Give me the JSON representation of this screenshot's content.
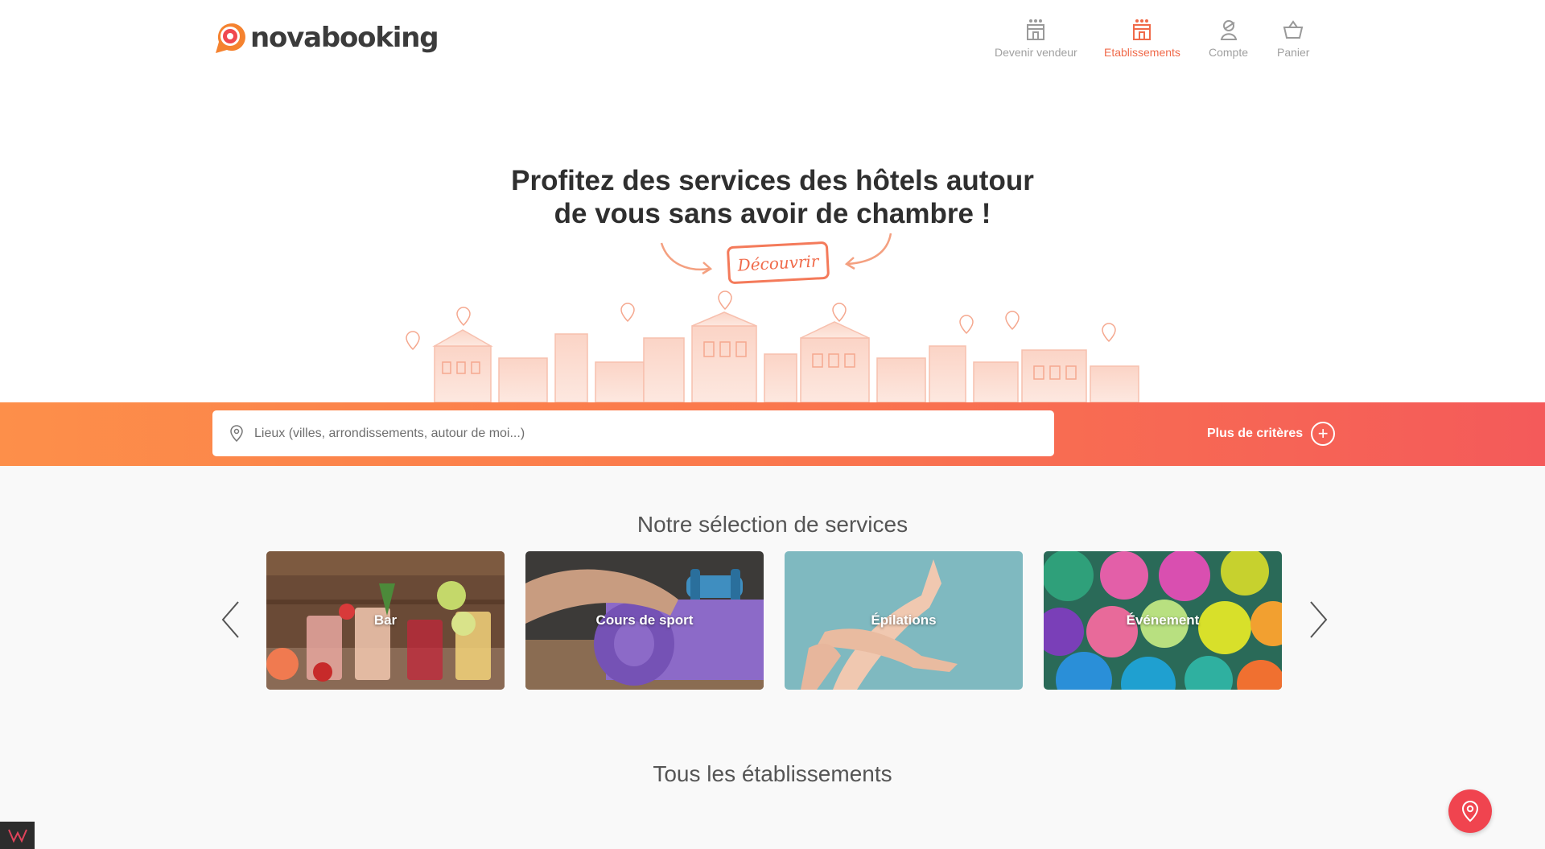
{
  "brand": {
    "name": "novabooking",
    "accent": "#f06a4a"
  },
  "nav": {
    "items": [
      {
        "label": "Devenir vendeur",
        "icon": "shop-icon",
        "active": false
      },
      {
        "label": "Etablissements",
        "icon": "hotel-icon",
        "active": true
      },
      {
        "label": "Compte",
        "icon": "user-icon",
        "active": false
      },
      {
        "label": "Panier",
        "icon": "basket-icon",
        "active": false
      }
    ]
  },
  "hero": {
    "title_line1": "Profitez des services des hôtels autour",
    "title_line2": "de vous sans avoir de chambre !",
    "cta": "Découvrir"
  },
  "search": {
    "placeholder": "Lieux (villes, arrondissements, autour de moi...)",
    "value": "",
    "criteria_label": "Plus de critères"
  },
  "services": {
    "title": "Notre sélection de services",
    "cards": [
      {
        "label": "Bar"
      },
      {
        "label": "Cours de sport"
      },
      {
        "label": "Épilations"
      },
      {
        "label": "Événement"
      }
    ]
  },
  "establishments": {
    "title": "Tous les établissements"
  }
}
